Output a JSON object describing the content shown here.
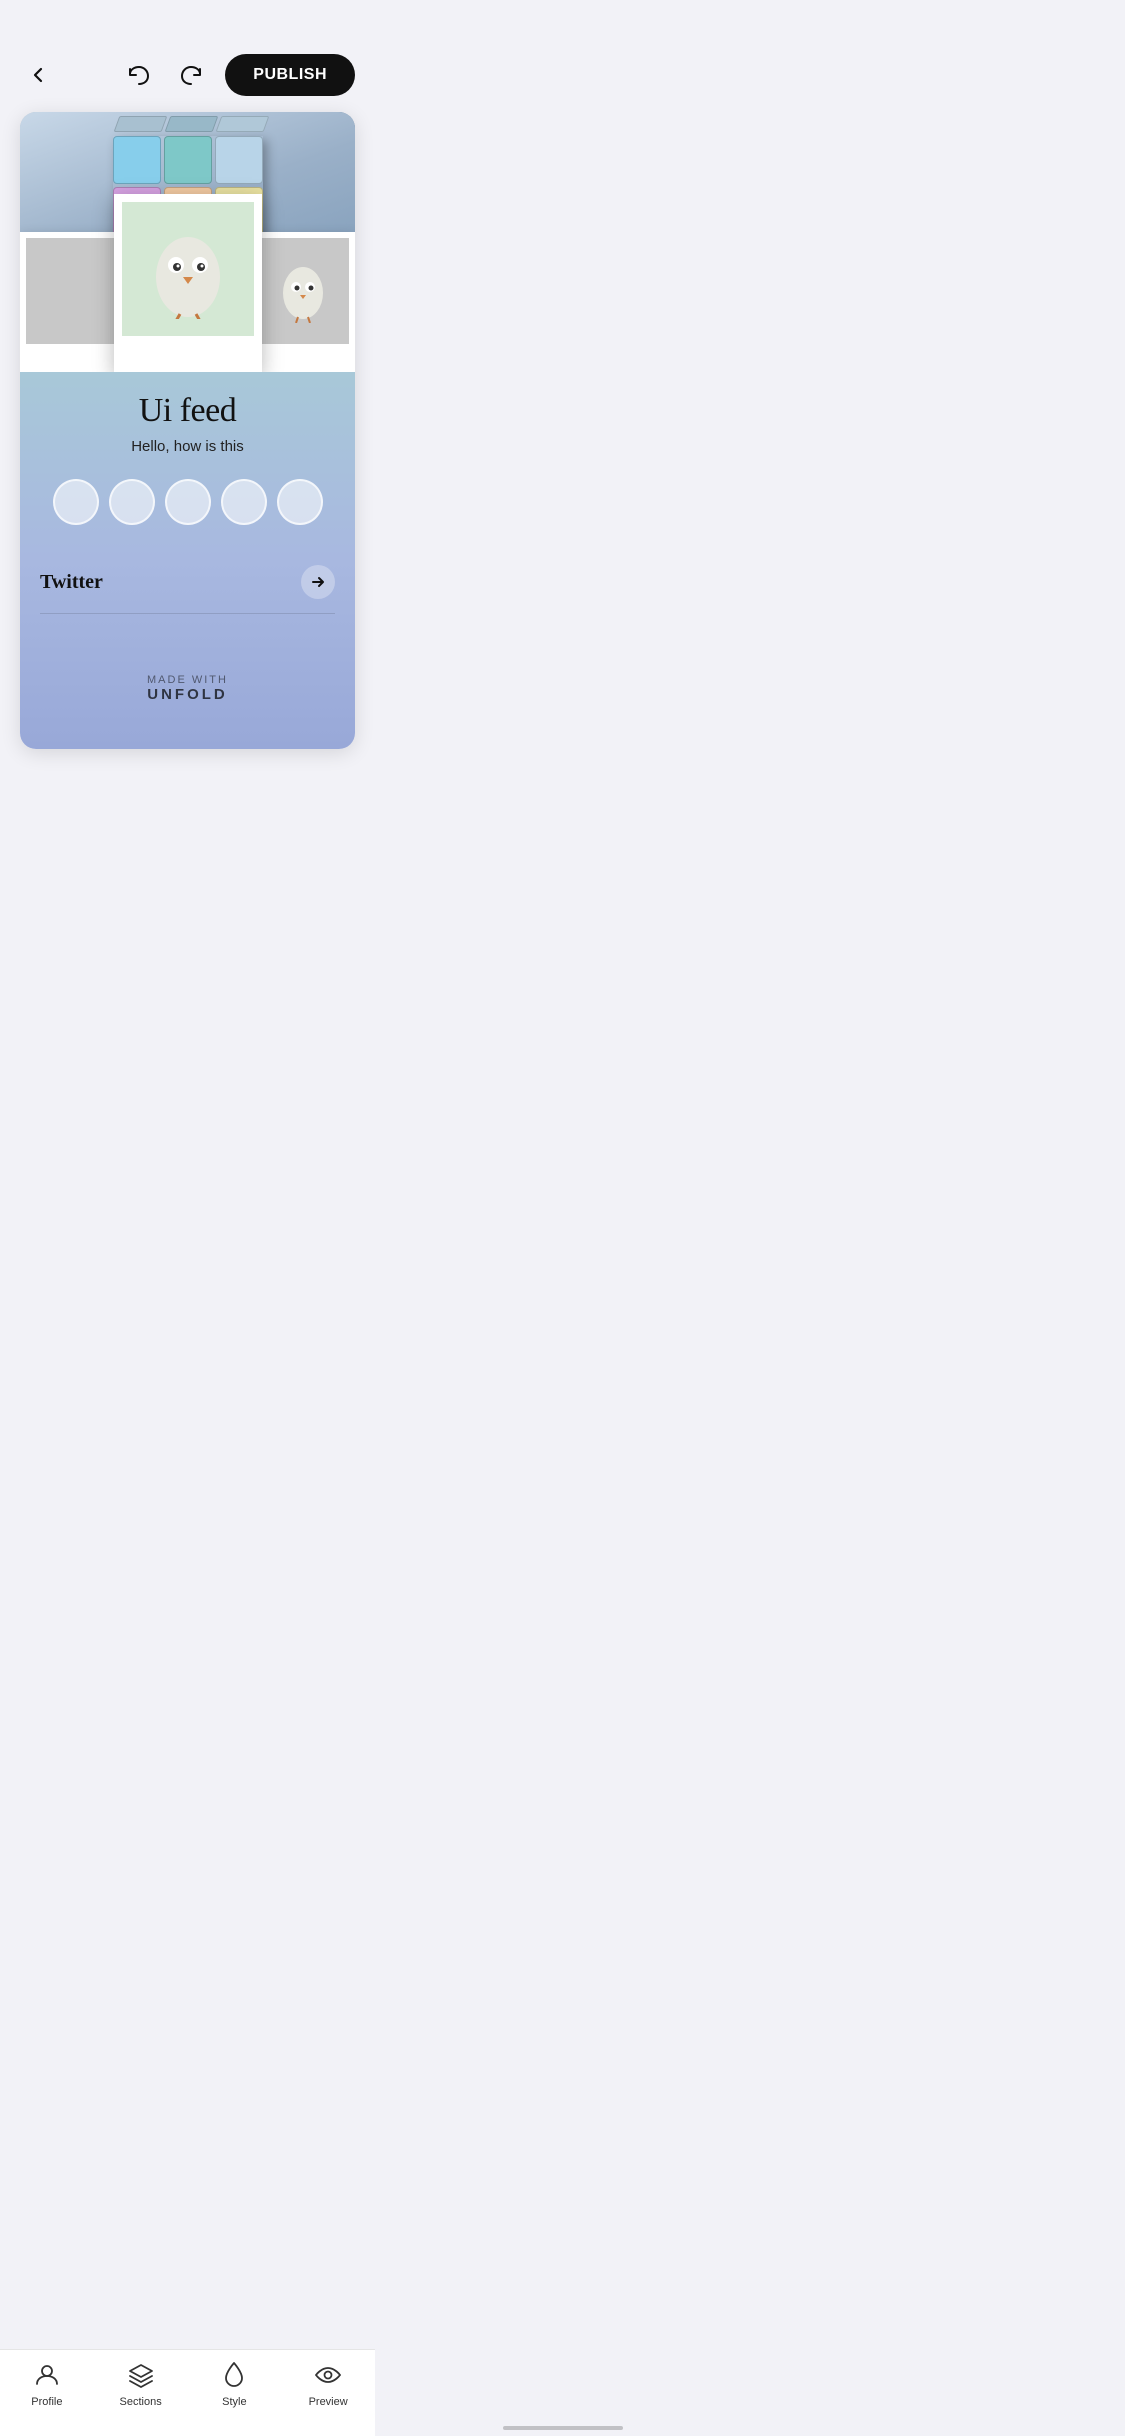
{
  "header": {
    "publish_label": "PUBLISH",
    "back_icon": "back-icon",
    "undo_icon": "undo-icon",
    "redo_icon": "redo-icon"
  },
  "story": {
    "title": "Ui feed",
    "subtitle": "Hello, how is this",
    "twitter_label": "Twitter",
    "made_with_label": "MADE WITH",
    "brand_label": "UNFOLD"
  },
  "rubik": {
    "colors": [
      "#7ec8c8",
      "#87CEEB",
      "#d4a0e0",
      "#e8c080",
      "#e88080",
      "#c8e880",
      "#8080e8",
      "#e8a060",
      "#80c8e8",
      "#f0d080",
      "#8888cc",
      "#88cc88",
      "#cc8888",
      "#d8d8d8",
      "#88cccc",
      "#c888c8",
      "#cccc88",
      "#8888aa"
    ]
  },
  "bottom_nav": {
    "items": [
      {
        "id": "profile",
        "label": "Profile",
        "icon": "person-icon"
      },
      {
        "id": "sections",
        "label": "Sections",
        "icon": "layers-icon"
      },
      {
        "id": "style",
        "label": "Style",
        "icon": "drop-icon"
      },
      {
        "id": "preview",
        "label": "Preview",
        "icon": "eye-icon"
      }
    ]
  }
}
